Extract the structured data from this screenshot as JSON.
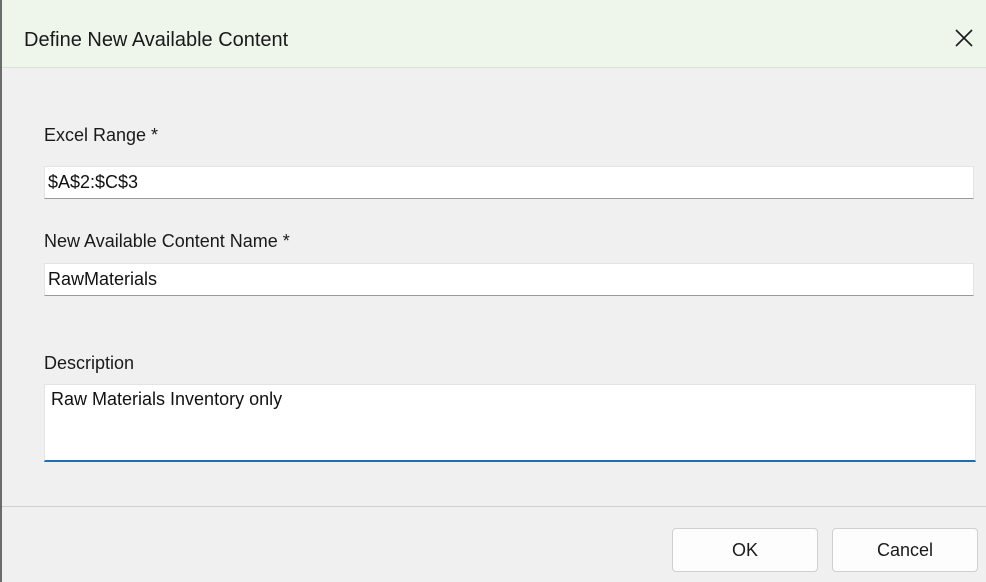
{
  "dialog": {
    "title": "Define New Available Content",
    "close_icon": "close-icon"
  },
  "fields": {
    "excel_range": {
      "label": "Excel Range *",
      "value": "$A$2:$C$3"
    },
    "content_name": {
      "label": "New Available Content Name *",
      "value": "RawMaterials"
    },
    "description": {
      "label": "Description",
      "value": "Raw Materials Inventory only"
    }
  },
  "buttons": {
    "ok_label": "OK",
    "cancel_label": "Cancel"
  },
  "colors": {
    "titlebar_bg": "#eef6ec",
    "focus_underline": "#1f6db3",
    "dialog_bg": "#f0f0f0"
  }
}
